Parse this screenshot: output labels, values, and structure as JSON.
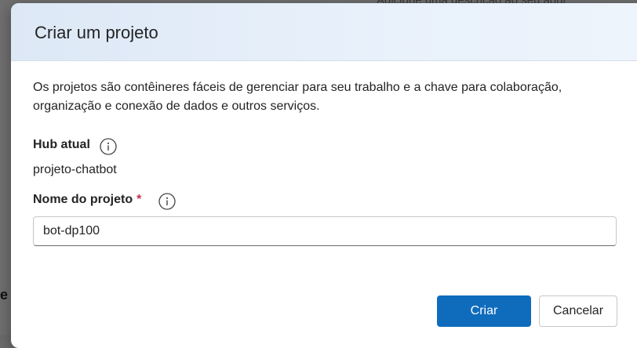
{
  "background": {
    "partial_text": "Adicione uma descrição ao seu agur",
    "edge_char": "e"
  },
  "dialog": {
    "title": "Criar um projeto",
    "description": "Os projetos são contêineres fáceis de gerenciar para seu trabalho e a chave para colaboração, organização e conexão de dados e outros serviços.",
    "hub": {
      "label": "Hub atual",
      "value": "projeto-chatbot"
    },
    "project_name": {
      "label": "Nome do projeto",
      "required_marker": "*",
      "value": "bot-dp100"
    },
    "buttons": {
      "create": "Criar",
      "cancel": "Cancelar"
    }
  },
  "colors": {
    "primary": "#0f6cbd",
    "required": "#c4314b",
    "header_gradient_start": "#dde8f6"
  },
  "icons": {
    "hub_info": "info-icon",
    "project_info": "info-icon"
  }
}
